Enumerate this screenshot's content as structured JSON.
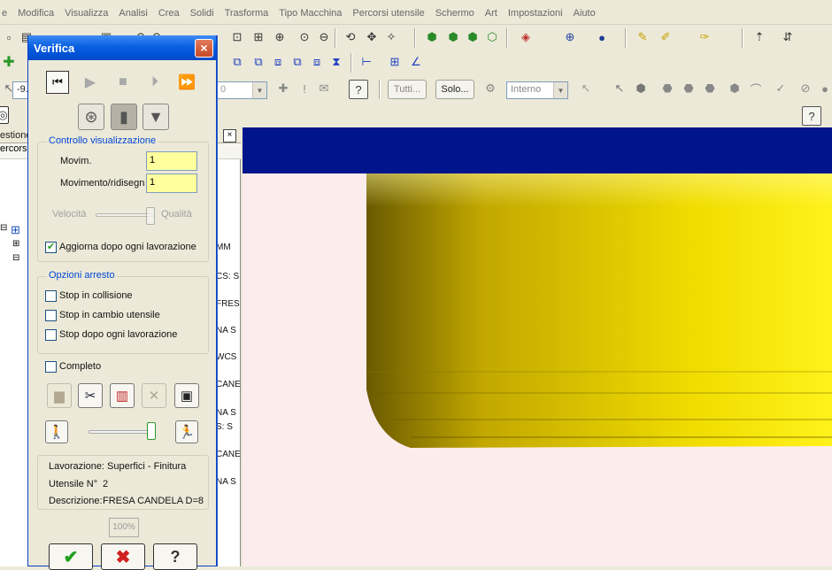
{
  "menu": [
    "e",
    "Modifica",
    "Visualizza",
    "Analisi",
    "Crea",
    "Solidi",
    "Trasforma",
    "Tipo Macchina",
    "Percorsi utensile",
    "Schermo",
    "Art",
    "Impostazioni",
    "Aiuto"
  ],
  "toolbar3": {
    "coord_value": "-9.",
    "combo_value": "0",
    "btn_tutti": "Tutti...",
    "btn_solo": "Solo...",
    "combo_interno": "Interno"
  },
  "leftpane": {
    "header": "estione",
    "sub": "ercorsi",
    "close": "×",
    "rows": [
      "MM",
      "CS: S",
      "FRES",
      "NA S",
      "WCS",
      "CANE",
      "NA S",
      "S: S",
      "CANE",
      "NA S"
    ]
  },
  "dialog": {
    "title": "Verifica",
    "close": "×",
    "group_display": "Controllo visualizzazione",
    "movim_label": "Movim.",
    "movim_value": "1",
    "redraw_label": "Movimento/ridisegna",
    "redraw_value": "1",
    "speed_label": "Velocità",
    "quality_label": "Qualità",
    "speed_level": 0.95,
    "update_label": "Aggiorna dopo ogni lavorazione",
    "group_stop": "Opzioni arresto",
    "stop_collision": "Stop in collisione",
    "stop_tool_change": "Stop in cambio utensile",
    "stop_each_op": "Stop dopo ogni lavorazione",
    "complete_label": "Completo",
    "run_speed_level": 1.0,
    "op_line": "Lavorazione: Superfici - Finitura",
    "tool_label": "Utensile N°",
    "tool_value": "2",
    "desc_label": "Descrizione:",
    "desc_value": "FRESA CANDELA D=8",
    "progress": "100%"
  },
  "colors": {
    "viewport_bg": "#fcecec",
    "viewport_band": "#00148c",
    "part_yellow": "#f2e000",
    "input_yellow": "#ffff9e",
    "title_blue": "#0a5fe0"
  }
}
